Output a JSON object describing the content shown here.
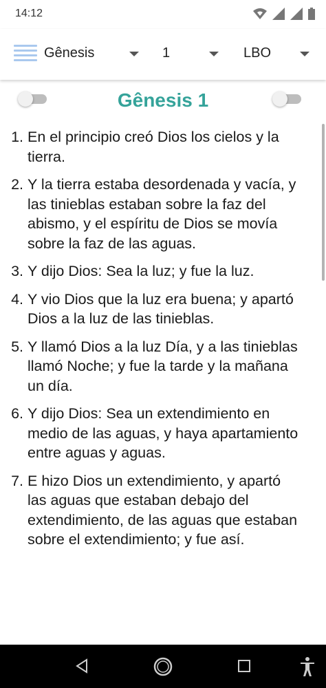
{
  "status_bar": {
    "time": "14:12"
  },
  "toolbar": {
    "book": "Gênesis",
    "chapter": "1",
    "version": "LBO"
  },
  "title": "Gênesis 1",
  "verses": [
    {
      "num": "1.",
      "text": "En el principio creó Dios los cielos y la tierra."
    },
    {
      "num": "2.",
      "text": "Y la tierra estaba desordenada y vacía, y las tinieblas estaban sobre la faz del abismo, y el espíritu de Dios se movía sobre la faz de las aguas."
    },
    {
      "num": "3.",
      "text": "Y dijo Dios: Sea la luz; y fue la luz."
    },
    {
      "num": "4.",
      "text": "Y vio Dios que la luz era buena; y apartó Dios a la luz de las tinieblas."
    },
    {
      "num": "5.",
      "text": "Y llamó Dios a la luz Día, y a las tinieblas llamó Noche; y fue la tarde y la mañana un día."
    },
    {
      "num": "6.",
      "text": "Y dijo Dios: Sea un extendimiento en medio de las aguas, y haya apartamiento entre aguas y aguas."
    },
    {
      "num": "7.",
      "text": "E hizo Dios un extendimiento, y apartó las aguas que estaban debajo del extendimiento, de las aguas que estaban sobre el extendimiento; y fue así."
    }
  ],
  "colors": {
    "title": "#35a39a",
    "menu_icon": "#a9c8ee",
    "nav_bar": "#000000"
  }
}
